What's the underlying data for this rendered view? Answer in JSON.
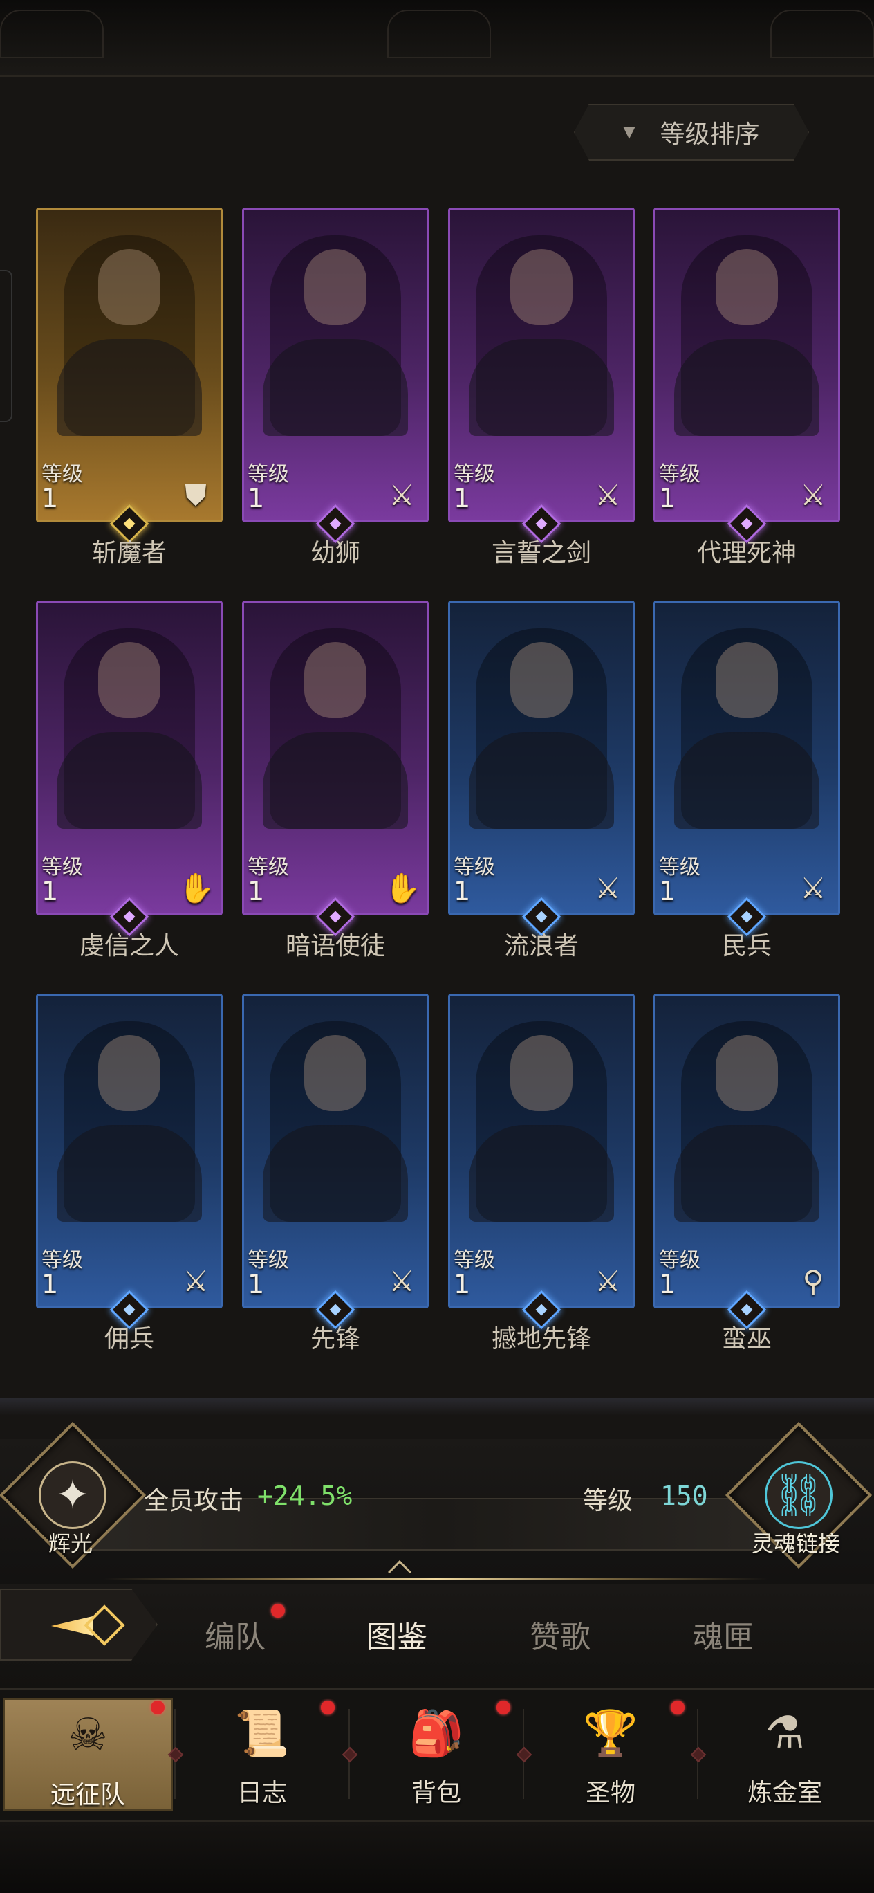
{
  "sort": {
    "label": "等级排序",
    "arrow": "▼"
  },
  "level_label": "等级",
  "heroes": [
    {
      "name": "斩魔者",
      "level": "1",
      "rarity": "gold",
      "role_icon": "shield-icon",
      "glyph": "⛊"
    },
    {
      "name": "幼狮",
      "level": "1",
      "rarity": "purple",
      "role_icon": "sword-icon",
      "glyph": "⚔"
    },
    {
      "name": "言誓之剑",
      "level": "1",
      "rarity": "purple",
      "role_icon": "sword-icon",
      "glyph": "⚔"
    },
    {
      "name": "代理死神",
      "level": "1",
      "rarity": "purple",
      "role_icon": "sword-icon",
      "glyph": "⚔"
    },
    {
      "name": "虔信之人",
      "level": "1",
      "rarity": "purple",
      "role_icon": "hand-icon",
      "glyph": "✋"
    },
    {
      "name": "暗语使徒",
      "level": "1",
      "rarity": "purple",
      "role_icon": "hand-icon",
      "glyph": "✋"
    },
    {
      "name": "流浪者",
      "level": "1",
      "rarity": "blue",
      "role_icon": "sword-icon",
      "glyph": "⚔"
    },
    {
      "name": "民兵",
      "level": "1",
      "rarity": "blue",
      "role_icon": "sword-icon",
      "glyph": "⚔"
    },
    {
      "name": "佣兵",
      "level": "1",
      "rarity": "blue",
      "role_icon": "sword-icon",
      "glyph": "⚔"
    },
    {
      "name": "先锋",
      "level": "1",
      "rarity": "blue",
      "role_icon": "sword-icon",
      "glyph": "⚔"
    },
    {
      "name": "撼地先锋",
      "level": "1",
      "rarity": "blue",
      "role_icon": "sword-icon",
      "glyph": "⚔"
    },
    {
      "name": "蛮巫",
      "level": "1",
      "rarity": "blue",
      "role_icon": "staff-icon",
      "glyph": "⚲"
    }
  ],
  "bonus": {
    "emblem_label": "辉光",
    "attack_label": "全员攻击",
    "attack_value": "+24.5%",
    "level_label": "等级",
    "level_value": "150",
    "soul_link_label": "灵魂链接"
  },
  "subtabs": [
    {
      "label": "编队",
      "active": false,
      "badge": true
    },
    {
      "label": "图鉴",
      "active": true,
      "badge": false
    },
    {
      "label": "赞歌",
      "active": false,
      "badge": false
    },
    {
      "label": "魂匣",
      "active": false,
      "badge": false
    }
  ],
  "nav": [
    {
      "label": "远征队",
      "icon": "helmet-icon",
      "glyph": "☠",
      "active": true,
      "badge": true
    },
    {
      "label": "日志",
      "icon": "scroll-icon",
      "glyph": "📜",
      "active": false,
      "badge": true
    },
    {
      "label": "背包",
      "icon": "bag-icon",
      "glyph": "🎒",
      "active": false,
      "badge": true
    },
    {
      "label": "圣物",
      "icon": "chalice-icon",
      "glyph": "🏆",
      "active": false,
      "badge": true
    },
    {
      "label": "炼金室",
      "icon": "alchemy-icon",
      "glyph": "⚗",
      "active": false,
      "badge": false
    }
  ]
}
